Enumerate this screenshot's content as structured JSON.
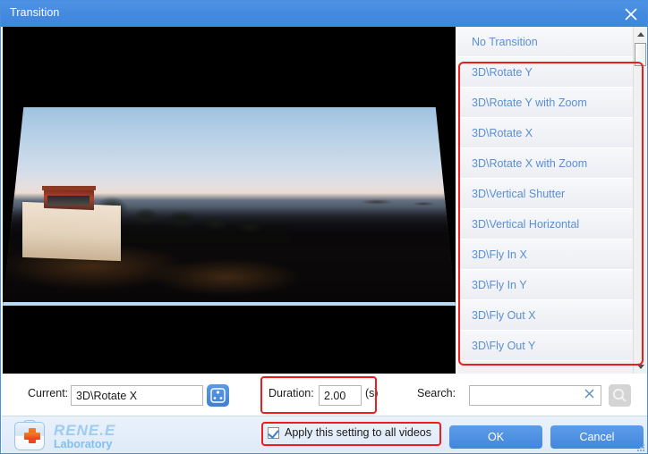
{
  "window": {
    "title": "Transition",
    "close_icon": "close-icon"
  },
  "preview": {
    "description": "Coastal sunset video frame with white lighthouse building, treeline and rocky shore, shown with 3D perspective transform"
  },
  "transition_list": {
    "items": [
      {
        "label": "No Transition"
      },
      {
        "label": "3D\\Rotate Y"
      },
      {
        "label": "3D\\Rotate Y with Zoom"
      },
      {
        "label": "3D\\Rotate X"
      },
      {
        "label": "3D\\Rotate X with Zoom"
      },
      {
        "label": "3D\\Vertical Shutter"
      },
      {
        "label": "3D\\Vertical Horizontal"
      },
      {
        "label": "3D\\Fly In X"
      },
      {
        "label": "3D\\Fly In Y"
      },
      {
        "label": "3D\\Fly Out X"
      },
      {
        "label": "3D\\Fly Out Y"
      }
    ],
    "scrollbar": {
      "up_icon": "scroll-up-arrow-icon",
      "down_icon": "scroll-down-arrow-icon"
    }
  },
  "fields": {
    "current_label": "Current:",
    "current_value": "3D\\Rotate X",
    "random_icon": "dice-icon",
    "duration_label": "Duration:",
    "duration_value": "2.00",
    "duration_unit": "(s)",
    "search_label": "Search:",
    "search_value": "",
    "search_placeholder": "",
    "clear_icon": "clear-x-icon",
    "search_icon": "search-icon"
  },
  "footer": {
    "logo_name": "RENE.E",
    "logo_sub": "Laboratory",
    "apply_label": "Apply this setting to all videos",
    "apply_checked": true,
    "ok_label": "OK",
    "cancel_label": "Cancel"
  },
  "colors": {
    "title_bar": "#4289df",
    "accent_blue": "#4387dc",
    "list_text": "#5b8fd4",
    "highlight_red": "#ee1c1c",
    "footer_bg": "#e2ecf9"
  }
}
